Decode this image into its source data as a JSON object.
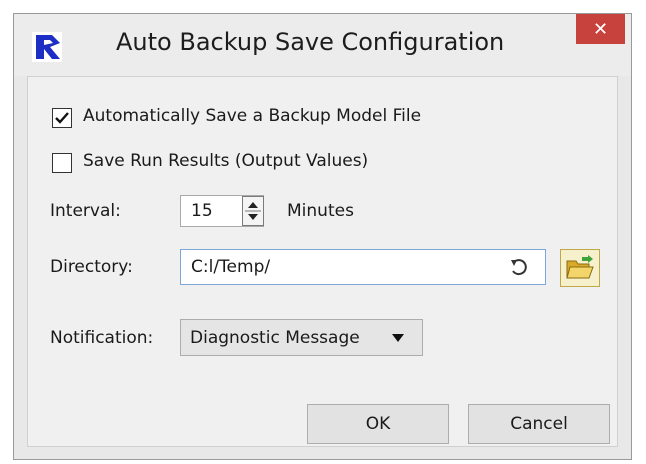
{
  "window": {
    "title": "Auto Backup Save Configuration",
    "close_glyph": "✕"
  },
  "options": {
    "auto_save": {
      "label": "Automatically Save a Backup Model File",
      "checked": true
    },
    "save_results": {
      "label": "Save Run Results (Output Values)",
      "checked": false
    }
  },
  "interval": {
    "label": "Interval:",
    "value": "15",
    "unit": "Minutes"
  },
  "directory": {
    "label": "Directory:",
    "value": "C:l/Temp/"
  },
  "notification": {
    "label": "Notification:",
    "value": "Diagnostic Message"
  },
  "buttons": {
    "ok": "OK",
    "cancel": "Cancel"
  },
  "colors": {
    "close_bg": "#c7413d",
    "input_border": "#7ea6d8",
    "folder": "#e8c04d"
  },
  "icons": {
    "app": "app-logo-icon",
    "reset": "reset-icon",
    "browse": "folder-open-icon",
    "dropdown": "dropdown-arrow-icon"
  }
}
